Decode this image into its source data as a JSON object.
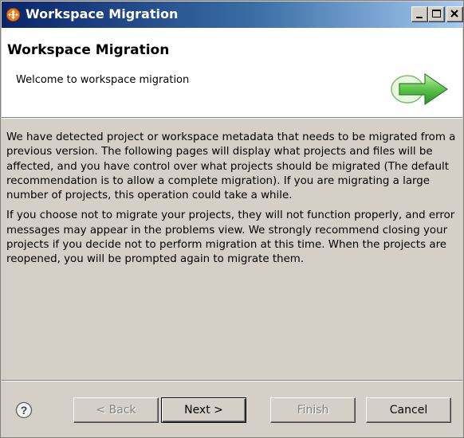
{
  "window": {
    "title": "Workspace Migration"
  },
  "banner": {
    "title": "Workspace Migration",
    "subtitle": "Welcome to workspace migration",
    "icon": "green-arrow-icon"
  },
  "content": {
    "paragraphs": [
      "We have detected project or workspace metadata that needs to be migrated from a previous version. The following pages will display what projects and files will be affected, and you have control over what projects should be migrated (The default recommendation is to allow a complete migration). If you are migrating a large number of projects, this operation could take a while.",
      "If you choose not to migrate your projects, they will not function properly, and  error messages may appear in the problems view. We strongly recommend closing your projects if you decide not to perform migration at this time. When the projects are reopened, you will be prompted again to migrate them."
    ]
  },
  "buttons": {
    "help_icon": "help-icon",
    "back": "< Back",
    "next": "Next >",
    "finish": "Finish",
    "cancel": "Cancel"
  },
  "colors": {
    "titlebar_start": "#0a246a",
    "titlebar_end": "#a6caf0",
    "dialog_bg": "#d4d0c8",
    "banner_bg": "#ffffff",
    "arrow_green": "#3fae3a"
  }
}
